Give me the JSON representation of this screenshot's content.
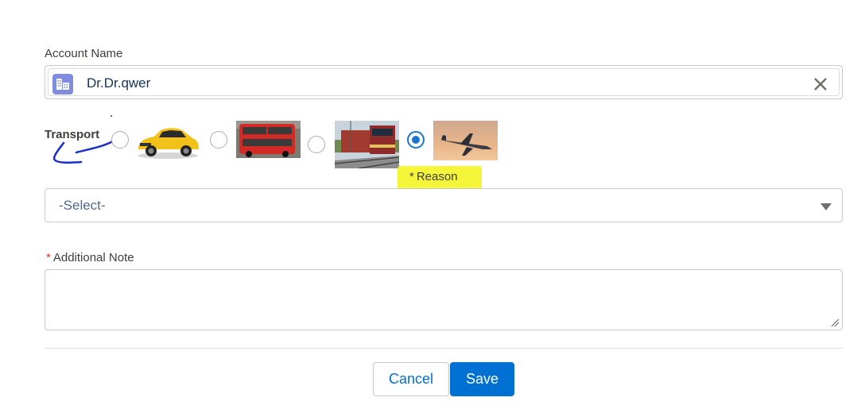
{
  "form": {
    "account_name_label": "Account Name",
    "account_name_value": "Dr.Dr.qwer",
    "account_icon": "account-building-icon",
    "clear_icon": "close-icon",
    "transport_label": "Transport",
    "transport_options": [
      {
        "name": "car",
        "image": "yellow sports car",
        "selected": false
      },
      {
        "name": "bus",
        "image": "red double-decker bus",
        "selected": false
      },
      {
        "name": "train",
        "image": "train on tracks",
        "selected": false
      },
      {
        "name": "plane",
        "image": "airplane at sunset",
        "selected": true
      }
    ],
    "reason_required_mark": "*",
    "reason_label": "Reason",
    "reason_select_value": "-Select-",
    "note_required_mark": "*",
    "note_label": "Additional Note",
    "note_value": "",
    "cancel_label": "Cancel",
    "save_label": "Save"
  },
  "colors": {
    "brand": "#0070d2",
    "radio_selected": "#1b75d0",
    "account_icon_bg": "#7f8de1",
    "highlight": "#f5f53a",
    "required": "#c23934",
    "annotation_ink": "#1a2fc9"
  }
}
